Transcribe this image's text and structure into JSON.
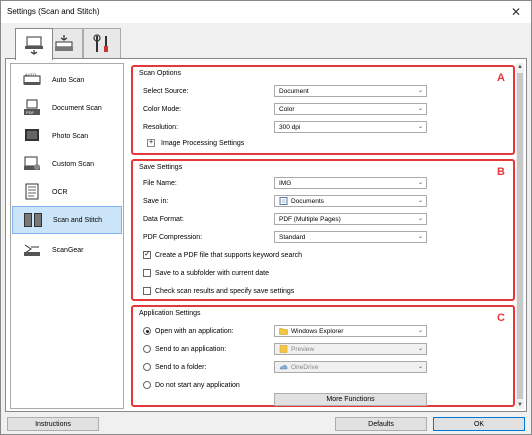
{
  "window": {
    "title": "Settings (Scan and Stitch)"
  },
  "tabs": [
    {
      "icon": "scan-from-computer-icon",
      "active": true
    },
    {
      "icon": "scan-from-panel-icon",
      "active": false
    },
    {
      "icon": "general-settings-icon",
      "active": false
    }
  ],
  "sidebar": {
    "items": [
      {
        "label": "Auto Scan",
        "icon": "auto-scan-icon"
      },
      {
        "label": "Document Scan",
        "icon": "document-scan-icon"
      },
      {
        "label": "Photo Scan",
        "icon": "photo-scan-icon"
      },
      {
        "label": "Custom Scan",
        "icon": "custom-scan-icon"
      },
      {
        "label": "OCR",
        "icon": "ocr-icon"
      },
      {
        "label": "Scan and Stitch",
        "icon": "scan-and-stitch-icon",
        "active": true
      },
      {
        "label": "ScanGear",
        "icon": "scangear-icon"
      }
    ]
  },
  "scan_options": {
    "title": "Scan Options",
    "letter": "A",
    "select_source_label": "Select Source:",
    "select_source_value": "Document",
    "color_mode_label": "Color Mode:",
    "color_mode_value": "Color",
    "resolution_label": "Resolution:",
    "resolution_value": "300 dpi",
    "image_processing_label": "Image Processing Settings"
  },
  "save_settings": {
    "title": "Save Settings",
    "letter": "B",
    "file_name_label": "File Name:",
    "file_name_value": "IMG",
    "save_in_label": "Save in:",
    "save_in_value": "Documents",
    "data_format_label": "Data Format:",
    "data_format_value": "PDF (Multiple Pages)",
    "pdf_compression_label": "PDF Compression:",
    "pdf_compression_value": "Standard",
    "keyword_search_label": "Create a PDF file that supports keyword search",
    "keyword_search_checked": true,
    "subfolder_label": "Save to a subfolder with current date",
    "subfolder_checked": false,
    "check_results_label": "Check scan results and specify save settings",
    "check_results_checked": false
  },
  "app_settings": {
    "title": "Application Settings",
    "letter": "C",
    "open_with_label": "Open with an application:",
    "open_with_value": "Windows Explorer",
    "send_to_app_label": "Send to an application:",
    "send_to_app_value": "Preview",
    "send_to_folder_label": "Send to a folder:",
    "send_to_folder_value": "OneDrive",
    "do_not_start_label": "Do not start any application",
    "more_functions_label": "More Functions",
    "selected": "open_with"
  },
  "footer": {
    "instructions_label": "Instructions",
    "defaults_label": "Defaults",
    "ok_label": "OK"
  },
  "colors": {
    "section_border": "#e53838",
    "selection_bg": "#cce4f7",
    "accent": "#0078d7"
  }
}
